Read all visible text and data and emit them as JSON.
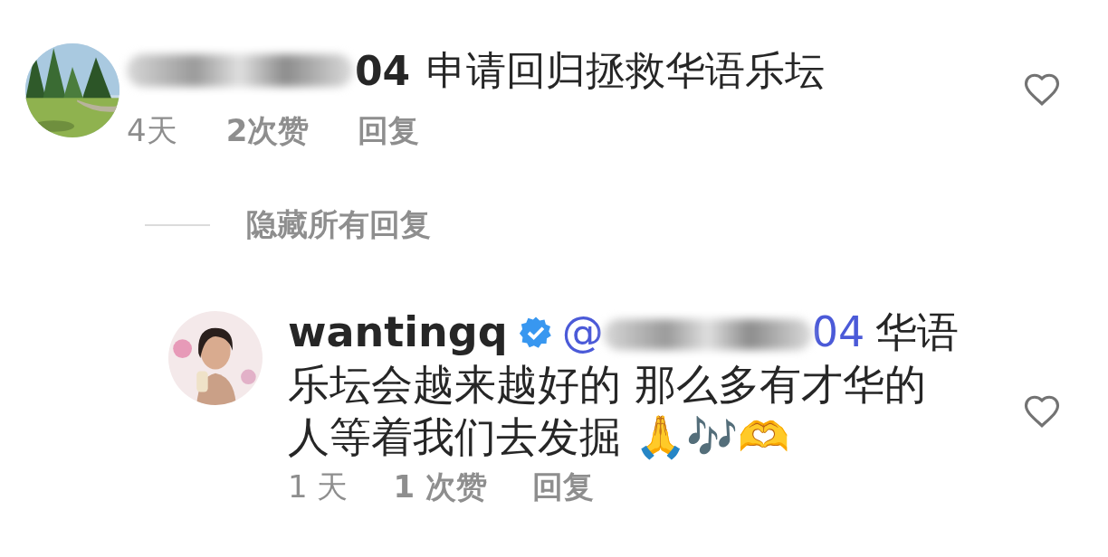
{
  "comments": [
    {
      "username": {
        "blurred": true,
        "visible": "04"
      },
      "text": "申请回归拯救华语乐坛",
      "time": "4天",
      "likes": "2次赞",
      "reply": "回复",
      "liked": false
    }
  ],
  "toggle_replies": "隐藏所有回复",
  "replies": [
    {
      "username": "wantingq",
      "verified": true,
      "mention": {
        "symbol": "@",
        "blurred": true,
        "visible": "04"
      },
      "text_lines": [
        "华语",
        "乐坛会越来越好的 那么多有才华的",
        "人等着我们去发掘 🙏🎶🫶"
      ],
      "time": "1 天",
      "likes": "1 次赞",
      "reply": "回复",
      "liked": false
    }
  ]
}
